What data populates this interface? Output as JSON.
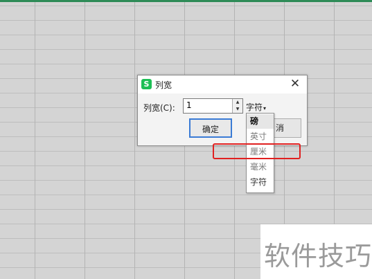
{
  "dialog": {
    "app_icon_letter": "S",
    "title": "列宽",
    "close_symbol": "✕",
    "label": "列宽(C):",
    "value": "1",
    "unit": "字符",
    "unit_arrow": "▾",
    "ok_label": "确定",
    "cancel_label_visible": "消",
    "spin_up": "▲",
    "spin_down": "▼"
  },
  "unit_dropdown": {
    "options": [
      "磅",
      "英寸",
      "厘米",
      "毫米",
      "字符"
    ],
    "selected": "磅"
  },
  "watermark": "软件技巧",
  "colors": {
    "highlight": "#e02020",
    "app_icon": "#1dbf55",
    "ok_border": "#3a7bd5",
    "top_line": "#2e8b57"
  }
}
